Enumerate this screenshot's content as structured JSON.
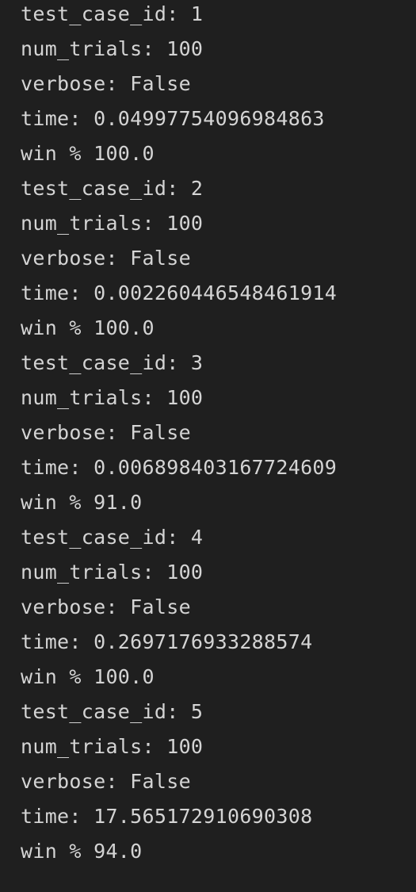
{
  "output_lines": [
    "test_case_id: 1",
    "num_trials: 100",
    "verbose: False",
    "time: 0.04997754096984863",
    "win % 100.0",
    "test_case_id: 2",
    "num_trials: 100",
    "verbose: False",
    "time: 0.002260446548461914",
    "win % 100.0",
    "test_case_id: 3",
    "num_trials: 100",
    "verbose: False",
    "time: 0.006898403167724609",
    "win % 91.0",
    "test_case_id: 4",
    "num_trials: 100",
    "verbose: False",
    "time: 0.2697176933288574",
    "win % 100.0",
    "test_case_id: 5",
    "num_trials: 100",
    "verbose: False",
    "time: 17.565172910690308",
    "win % 94.0"
  ],
  "theme": {
    "background": "#1f1f1f",
    "text": "#d4d4d4"
  }
}
